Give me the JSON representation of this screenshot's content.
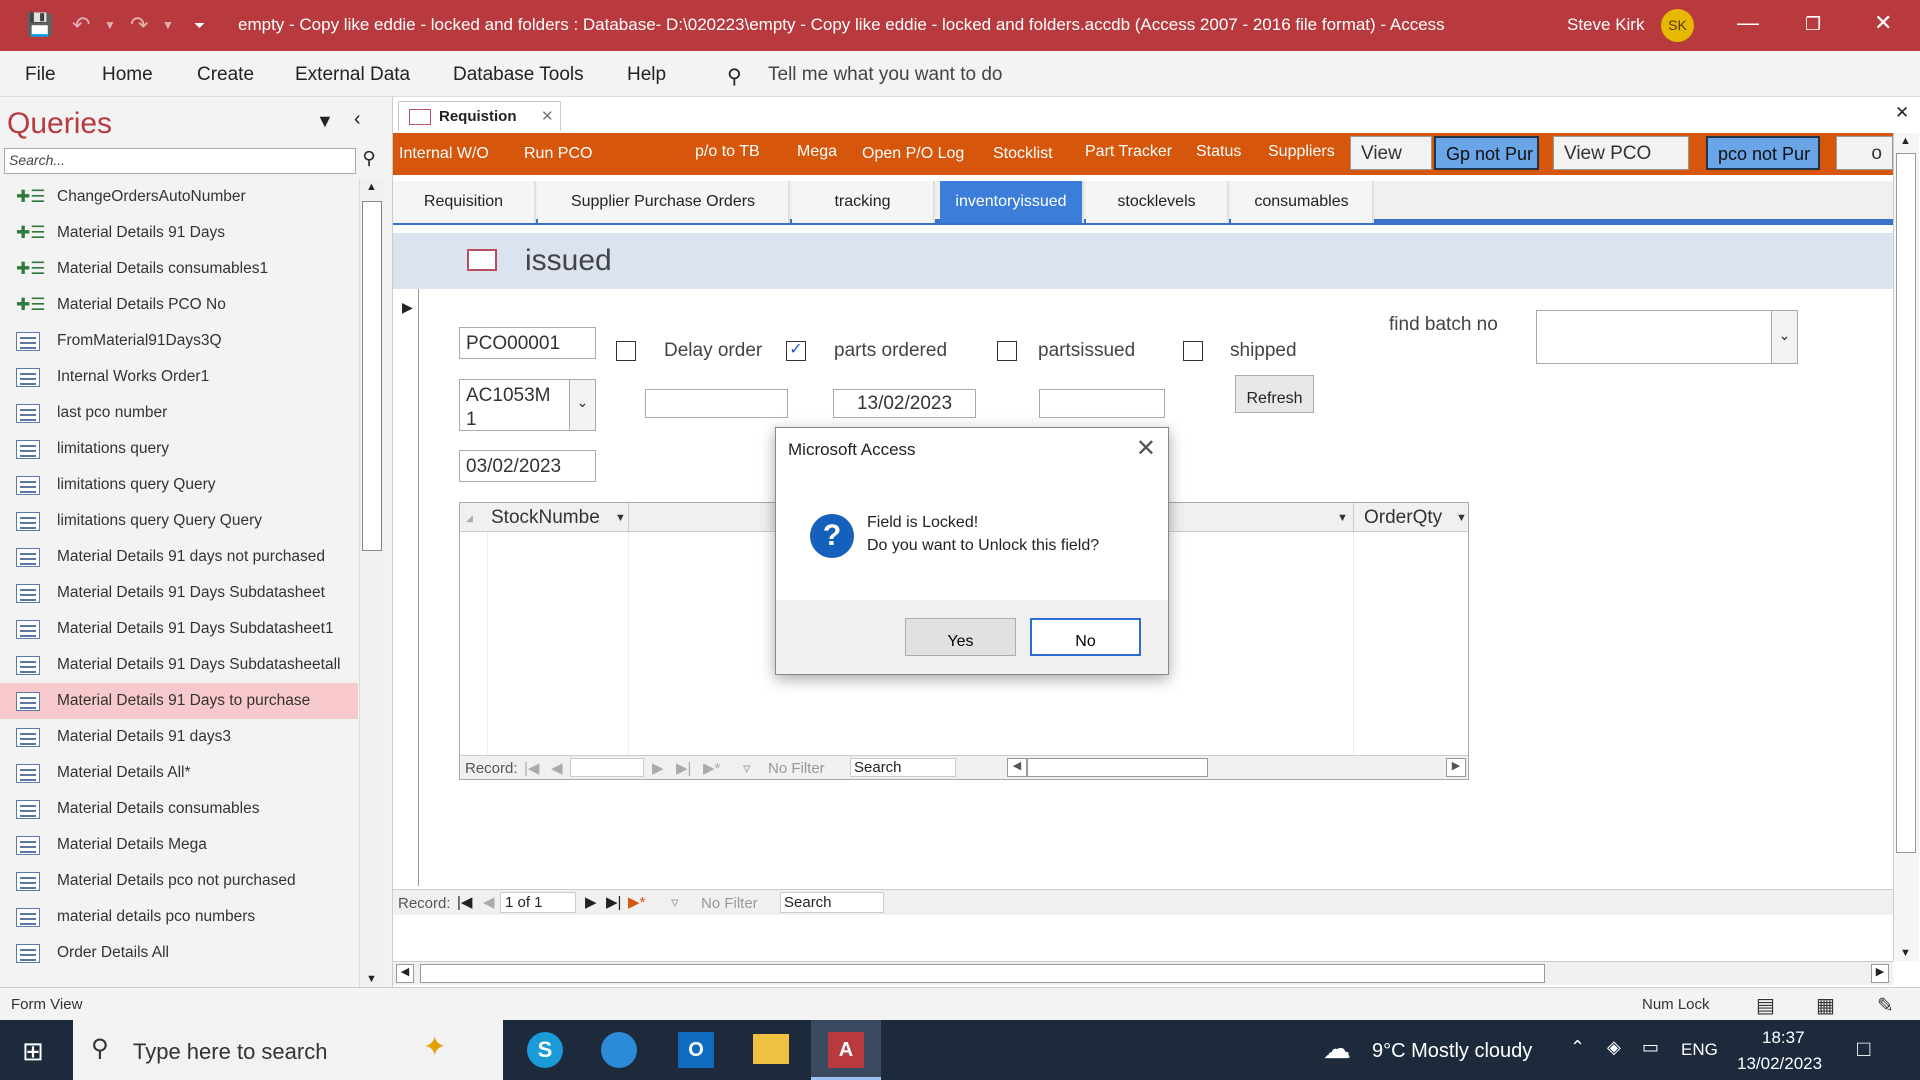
{
  "window": {
    "title": "empty - Copy like eddie - locked and folders : Database- D:\\020223\\empty - Copy like eddie - locked and folders.accdb (Access 2007 - 2016 file format)  -  Access",
    "user": "Steve Kirk",
    "initials": "SK"
  },
  "menu": {
    "file": "File",
    "home": "Home",
    "create": "Create",
    "external": "External Data",
    "dbtools": "Database Tools",
    "help": "Help",
    "tell": "Tell me what you want to do"
  },
  "nav": {
    "header": "Queries",
    "search_placeholder": "Search...",
    "items": [
      {
        "label": "ChangeOrdersAutoNumber",
        "type": "append"
      },
      {
        "label": "Material Details 91 Days",
        "type": "append"
      },
      {
        "label": "Material Details consumables1",
        "type": "append"
      },
      {
        "label": "Material Details PCO  No",
        "type": "append"
      },
      {
        "label": "FromMaterial91Days3Q",
        "type": "select"
      },
      {
        "label": "Internal Works Order1",
        "type": "select"
      },
      {
        "label": "last pco number",
        "type": "select"
      },
      {
        "label": "limitations query",
        "type": "select"
      },
      {
        "label": "limitations query Query",
        "type": "select"
      },
      {
        "label": "limitations query Query Query",
        "type": "select"
      },
      {
        "label": "Material Details 91 days  not purchased",
        "type": "select"
      },
      {
        "label": "Material Details 91 Days Subdatasheet",
        "type": "select"
      },
      {
        "label": "Material Details 91 Days Subdatasheet1",
        "type": "select"
      },
      {
        "label": "Material Details 91 Days Subdatasheetall",
        "type": "select"
      },
      {
        "label": "Material Details 91 Days to purchase",
        "type": "select",
        "selected": true
      },
      {
        "label": "Material Details 91 days3",
        "type": "select"
      },
      {
        "label": "Material Details All*",
        "type": "select"
      },
      {
        "label": "Material Details consumables",
        "type": "select"
      },
      {
        "label": "Material Details Mega",
        "type": "select"
      },
      {
        "label": "Material Details pco  not purchased",
        "type": "select"
      },
      {
        "label": "material details pco numbers",
        "type": "select"
      },
      {
        "label": "Order Details All",
        "type": "select"
      }
    ]
  },
  "doc": {
    "tab_label": "Requistion",
    "toolbar": {
      "internal_wo": "Internal W/O",
      "run_pco": "Run PCO",
      "po_to_tb": "p/o to TB",
      "mega": "Mega",
      "open_po_log": "Open P/O Log",
      "stocklist": "Stocklist",
      "part_tracker": "Part Tracker",
      "status": "Status",
      "suppliers": "Suppliers",
      "view": "View",
      "gp_not_pur": "Gp not Pur",
      "view_pco": "View PCO",
      "pco_not_pur": "pco not Pur",
      "overflow": "o"
    },
    "subtabs": [
      "Requisition",
      "Supplier Purchase Orders",
      "tracking",
      "inventoryissued",
      "stocklevels",
      "consumables"
    ],
    "form_title": "issued",
    "fields": {
      "pco": "PCO00001",
      "combo_value": "AC1053M 1",
      "date_issued": "03/02/2023",
      "parts_date": "13/02/2023",
      "delay_label": "Delay order",
      "parts_ordered_label": "parts ordered",
      "partsissued_label": "partsissued",
      "shipped_label": "shipped",
      "find_batch_label": "find batch no",
      "refresh": "Refresh"
    },
    "subform": {
      "col1": "StockNumbe",
      "col_last": "OrderQty",
      "record_label": "Record:",
      "no_filter": "No Filter",
      "search": "Search"
    },
    "mainnav": {
      "record_label": "Record:",
      "position": "1 of 1",
      "no_filter": "No Filter",
      "search": "Search"
    }
  },
  "dialog": {
    "title": "Microsoft Access",
    "line1": "Field is Locked!",
    "line2": "Do you want to Unlock this field?",
    "yes": "Yes",
    "no": "No"
  },
  "status": {
    "left": "Form View",
    "numlock": "Num Lock"
  },
  "taskbar": {
    "search": "Type here to search",
    "weather": "9°C  Mostly cloudy",
    "lang": "ENG",
    "time": "18:37",
    "date": "13/02/2023"
  },
  "colors": {
    "title_bar": "#b83a3f",
    "orange_toolbar": "#d6570c",
    "active_tab": "#3b7dd8",
    "selected_nav": "#f8c9cc"
  }
}
